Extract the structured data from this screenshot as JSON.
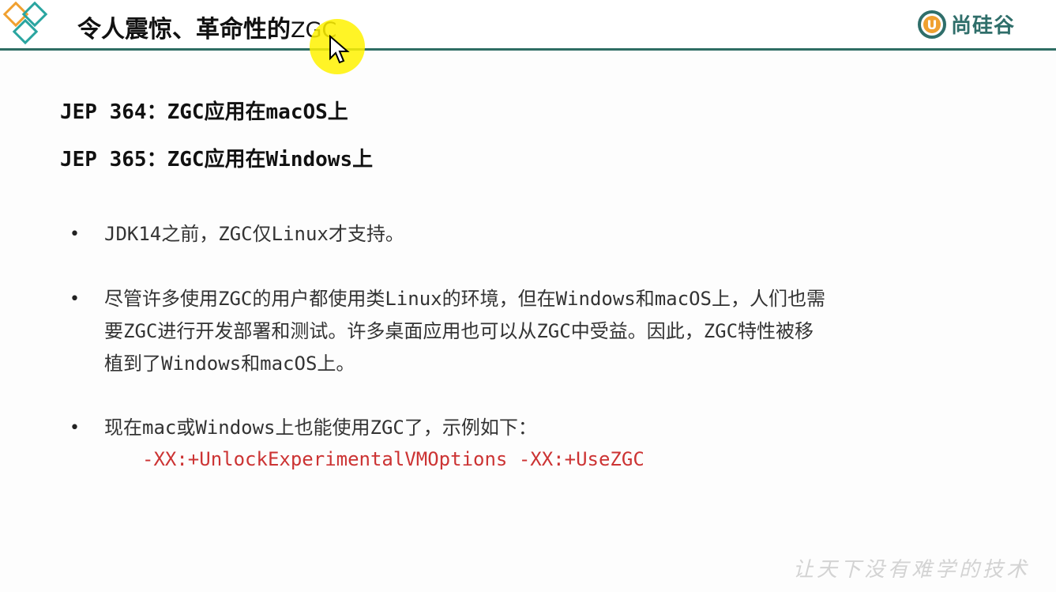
{
  "header": {
    "title_main": "令人震惊、革命性的",
    "title_zgc": "ZGC",
    "logo_text": "尚硅谷",
    "logo_mark": "U"
  },
  "jeps": [
    {
      "text": "JEP 364：ZGC应用在macOS上"
    },
    {
      "text": "JEP 365：ZGC应用在Windows上"
    }
  ],
  "bullets": [
    {
      "marker": "•",
      "lines": [
        "JDK14之前，ZGC仅Linux才支持。"
      ]
    },
    {
      "marker": "•",
      "lines": [
        "尽管许多使用ZGC的用户都使用类Linux的环境，但在Windows和macOS上，人们也需",
        "要ZGC进行开发部署和测试。许多桌面应用也可以从ZGC中受益。因此，ZGC特性被移",
        "植到了Windows和macOS上。"
      ]
    },
    {
      "marker": "•",
      "lines": [
        "现在mac或Windows上也能使用ZGC了，示例如下："
      ]
    }
  ],
  "code": "-XX:+UnlockExperimentalVMOptions -XX:+UseZGC",
  "watermark": "让天下没有难学的技术",
  "colors": {
    "accent_teal": "#2e6d63",
    "code_red": "#cc3333",
    "diamond_orange": "#f0a030",
    "diamond_teal": "#2aa5a0"
  }
}
